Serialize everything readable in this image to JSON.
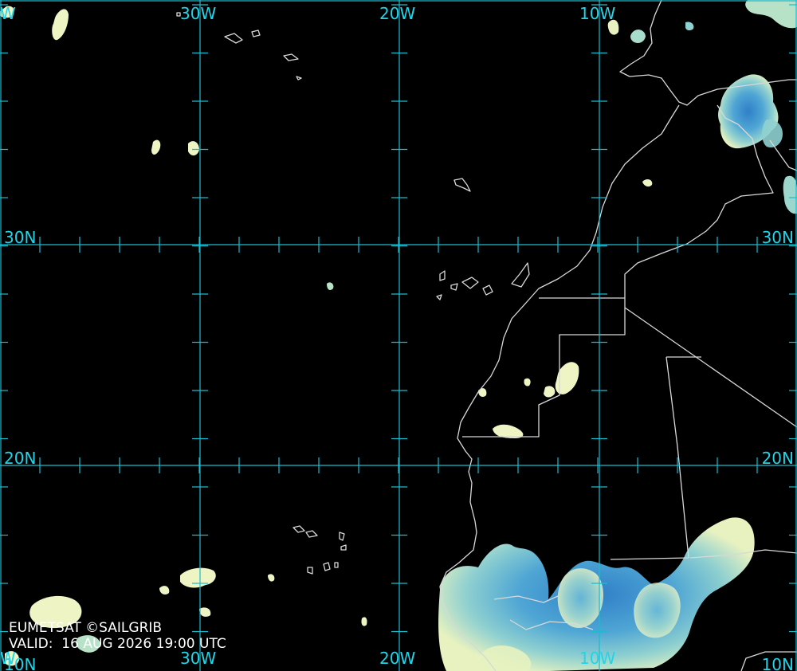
{
  "colors": {
    "background": "#000000",
    "grid": "#1bbcd0",
    "label": "#22d4e8",
    "coastline": "#d8d8d8",
    "cloud_light": "#f4f6c0",
    "cloud_mid": "#8fd0d0",
    "cloud_deep": "#3a8ed0",
    "credit_text": "#ffffff"
  },
  "longitude_labels": {
    "top": [
      "W",
      "30W",
      "20W",
      "10W"
    ],
    "bottom": [
      "W",
      "30W",
      "20W",
      "10W"
    ]
  },
  "latitude_labels": {
    "left": [
      "30N",
      "20N",
      "10N"
    ],
    "right": [
      "30N",
      "20N",
      "10N"
    ]
  },
  "credit": {
    "source": "EUMETSAT ©SAILGRIB",
    "valid": "VALID:  16 AUG 2026 19:00 UTC"
  },
  "icons": {
    "map": "satellite-cloud-map",
    "coastlines": "coastline-outline",
    "borders": "country-border-lines"
  }
}
